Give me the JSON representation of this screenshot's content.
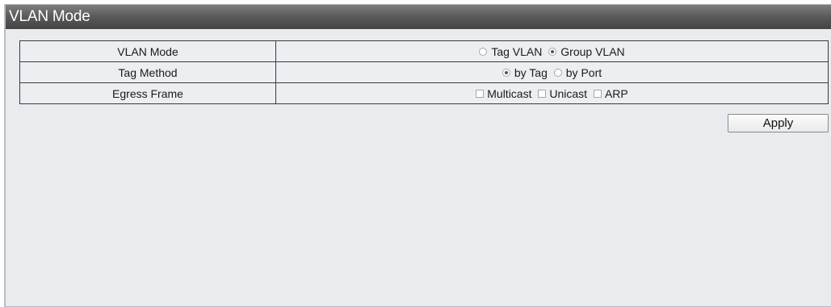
{
  "panel": {
    "title": "VLAN Mode"
  },
  "rows": [
    {
      "label": "VLAN Mode",
      "options": [
        {
          "type": "radio",
          "label": "Tag VLAN",
          "checked": false
        },
        {
          "type": "radio",
          "label": "Group VLAN",
          "checked": true
        }
      ]
    },
    {
      "label": "Tag Method",
      "options": [
        {
          "type": "radio",
          "label": "by Tag",
          "checked": true
        },
        {
          "type": "radio",
          "label": "by Port",
          "checked": false
        }
      ]
    },
    {
      "label": "Egress Frame",
      "options": [
        {
          "type": "checkbox",
          "label": "Multicast",
          "checked": false
        },
        {
          "type": "checkbox",
          "label": "Unicast",
          "checked": false
        },
        {
          "type": "checkbox",
          "label": "ARP",
          "checked": false
        }
      ]
    }
  ],
  "actions": {
    "apply_label": "Apply"
  }
}
